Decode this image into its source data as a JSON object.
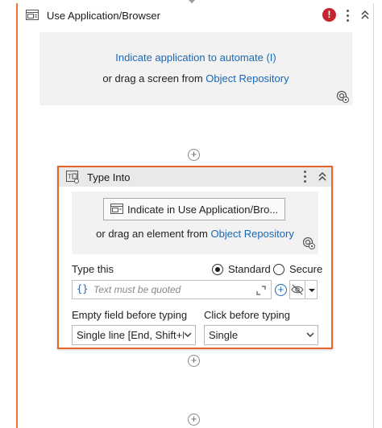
{
  "outer": {
    "title": "Use Application/Browser",
    "error_badge": "!",
    "drop_zone": {
      "link_text": "Indicate application to automate (I)",
      "line2_prefix": "or drag a screen from",
      "line2_link": "Object Repository"
    }
  },
  "inner": {
    "title": "Type Into",
    "indicate_button_label": "Indicate in Use Application/Bro...",
    "drop_line_prefix": "or drag an element from",
    "drop_line_link": "Object Repository",
    "type_this_label": "Type this",
    "radio_standard": "Standard",
    "radio_secure": "Secure",
    "selected_mode": "Standard",
    "text_input_placeholder": "Text must be quoted",
    "text_input_prefix": "{}",
    "empty_field_label": "Empty field before typing",
    "empty_field_value": "Single line [End, Shift+H",
    "click_before_label": "Click before typing",
    "click_before_value": "Single"
  },
  "colors": {
    "accent_orange": "#e8652a",
    "link_blue": "#1a68b4",
    "error_red": "#c4262e"
  },
  "icons": [
    "use-application-icon",
    "type-into-icon",
    "error-icon",
    "more-options-icon",
    "collapse-icon",
    "target-settings-icon",
    "add-activity-icon",
    "expand-editor-icon",
    "add-variable-icon",
    "hide-text-icon"
  ]
}
